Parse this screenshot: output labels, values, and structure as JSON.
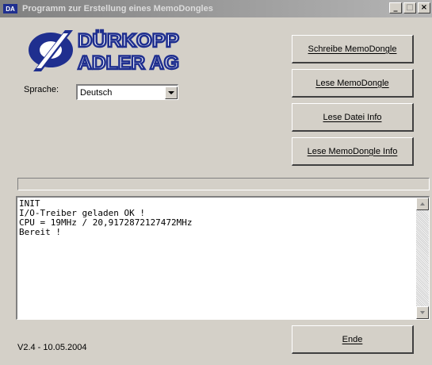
{
  "window": {
    "icon_text": "DA",
    "title": "Programm zur Erstellung eines MemoDongles",
    "controls": {
      "minimize": "_",
      "maximize": "□",
      "close": "×"
    }
  },
  "logo": {
    "line1": "DÜRKOPP",
    "line2": "ADLER AG",
    "color": "#1f2f8f"
  },
  "language": {
    "label": "Sprache:",
    "value": "Deutsch"
  },
  "buttons": {
    "write": "Schreibe MemoDongle",
    "read": "Lese MemoDongle",
    "file_info": "Lese Datei Info",
    "dongle_info": "Lese MemoDongle Info",
    "end": "Ende"
  },
  "progress": {
    "value": 0
  },
  "log": {
    "text": "INIT\nI/O-Treiber geladen OK !\nCPU = 19MHz / 20,9172872127472MHz\nBereit !"
  },
  "version": "V2.4 - 10.05.2004"
}
